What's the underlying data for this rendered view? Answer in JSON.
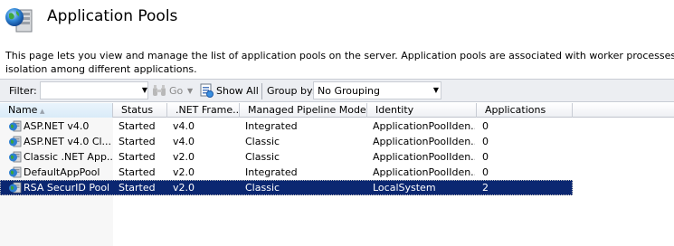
{
  "header": {
    "title": "Application Pools",
    "description_line1": "This page lets you view and manage the list of application pools on the server. Application pools are associated with worker processes, contain one or more",
    "description_line2": "isolation among different applications."
  },
  "toolbar": {
    "filter_label": "Filter:",
    "filter_value": "",
    "go_label": "Go",
    "show_all_label": "Show All",
    "group_by_label": "Group by:",
    "group_by_value": "No Grouping"
  },
  "grid": {
    "columns": [
      "Name",
      "Status",
      ".NET Frame...",
      "Managed Pipeline Mode",
      "Identity",
      "Applications"
    ],
    "rows": [
      {
        "name": "ASP.NET v4.0",
        "status": "Started",
        "framework": "v4.0",
        "pipeline": "Integrated",
        "identity": "ApplicationPoolIden...",
        "applications": "0",
        "icon": "app-pool-icon"
      },
      {
        "name": "ASP.NET v4.0 Cl...",
        "status": "Started",
        "framework": "v4.0",
        "pipeline": "Classic",
        "identity": "ApplicationPoolIden...",
        "applications": "0",
        "icon": "app-pool-icon"
      },
      {
        "name": "Classic .NET App...",
        "status": "Started",
        "framework": "v2.0",
        "pipeline": "Classic",
        "identity": "ApplicationPoolIden...",
        "applications": "0",
        "icon": "app-pool-icon"
      },
      {
        "name": "DefaultAppPool",
        "status": "Started",
        "framework": "v2.0",
        "pipeline": "Integrated",
        "identity": "ApplicationPoolIden...",
        "applications": "0",
        "icon": "app-pool-icon"
      },
      {
        "name": "RSA SecurID Pool",
        "status": "Started",
        "framework": "v2.0",
        "pipeline": "Classic",
        "identity": "LocalSystem",
        "applications": "2",
        "icon": "app-pool-icon",
        "selected": true
      }
    ]
  },
  "colors": {
    "selection": "#0b2771",
    "toolbar_bg": "#eceef2"
  }
}
